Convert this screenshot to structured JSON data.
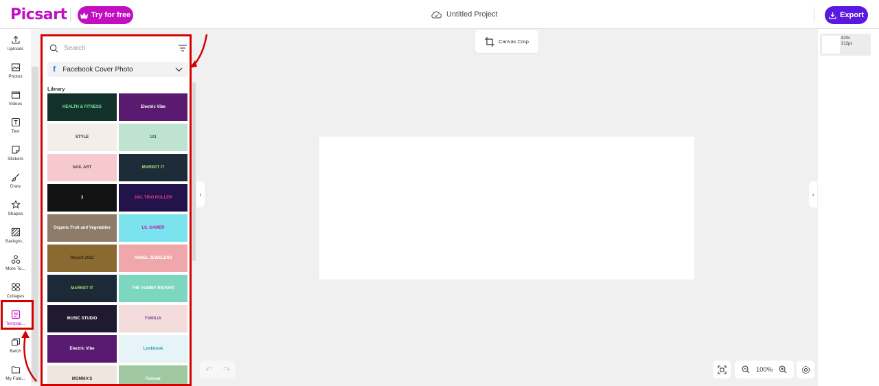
{
  "header": {
    "logo": "Picsart",
    "try_label": "Try for free",
    "project_title": "Untitled Project",
    "export_label": "Export",
    "brand_color": "#c10fc1",
    "export_color": "#5a19e0"
  },
  "rail": {
    "items": [
      {
        "label": "Uploads",
        "icon": "upload-icon"
      },
      {
        "label": "Photos",
        "icon": "image-icon"
      },
      {
        "label": "Videos",
        "icon": "video-icon"
      },
      {
        "label": "Text",
        "icon": "text-icon"
      },
      {
        "label": "Stickers",
        "icon": "sticker-icon"
      },
      {
        "label": "Draw",
        "icon": "brush-icon"
      },
      {
        "label": "Shapes",
        "icon": "star-icon"
      },
      {
        "label": "Backgro...",
        "icon": "background-icon"
      },
      {
        "label": "More To...",
        "icon": "more-tools-icon"
      },
      {
        "label": "Collages",
        "icon": "collage-icon"
      },
      {
        "label": "Templat...",
        "icon": "template-icon"
      },
      {
        "label": "Batch",
        "icon": "batch-icon"
      },
      {
        "label": "My Fold...",
        "icon": "folder-icon"
      }
    ],
    "active": "Templat..."
  },
  "panel": {
    "search_placeholder": "Search",
    "format_selected": "Facebook Cover Photo",
    "library_title": "Library",
    "templates": [
      {
        "text": "HEALTH & FITNESS",
        "bg": "#12312a",
        "color": "#7fe3a0"
      },
      {
        "text": "Electric Vibe",
        "bg": "#5a1a70",
        "color": "#ffffff"
      },
      {
        "text": "STYLE",
        "bg": "#f4eee8",
        "color": "#333333"
      },
      {
        "text": "101",
        "bg": "#bfe3d1",
        "color": "#1f6b4d"
      },
      {
        "text": "NAIL ART",
        "bg": "#f6c9cf",
        "color": "#5b3b3b"
      },
      {
        "text": "MARKET IT",
        "bg": "#1e2c3a",
        "color": "#a7e06b"
      },
      {
        "text": "3",
        "bg": "#121212",
        "color": "#ffffff"
      },
      {
        "text": "JAIL TRIO ROLLER",
        "bg": "#22144a",
        "color": "#e63a8a"
      },
      {
        "text": "Organic Fruit and Vegetables",
        "bg": "#8e7b6a",
        "color": "#ffffff"
      },
      {
        "text": "LIL GAMER",
        "bg": "#7be3ee",
        "color": "#c212b0"
      },
      {
        "text": "Resort 2022",
        "bg": "#8a6a30",
        "color": "#3b2a10"
      },
      {
        "text": "ANGEL JEWELERS",
        "bg": "#f0a7ac",
        "color": "#ffffff"
      },
      {
        "text": "MARKET IT",
        "bg": "#1c2a38",
        "color": "#a7e06b"
      },
      {
        "text": "THE YUMMY REPORT",
        "bg": "#7dd6c0",
        "color": "#ffffff"
      },
      {
        "text": "MUSIC STUDIO",
        "bg": "#201a30",
        "color": "#ffffff"
      },
      {
        "text": "FAMILIA",
        "bg": "#f4dcdc",
        "color": "#7b4fa0"
      },
      {
        "text": "Electric Vibe",
        "bg": "#5a1a70",
        "color": "#ffffff"
      },
      {
        "text": "Lookbook",
        "bg": "#e6f4f8",
        "color": "#2a9ab0"
      },
      {
        "text": "MOMMA'S",
        "bg": "#efe6e0",
        "color": "#3b2e28"
      },
      {
        "text": "Forever",
        "bg": "#9fc7a0",
        "color": "#ffffff"
      }
    ]
  },
  "canvas": {
    "crop_label": "Canvas Crop",
    "zoom": "100%"
  },
  "right_panel": {
    "size_line1": "820x",
    "size_line2": "312px"
  }
}
